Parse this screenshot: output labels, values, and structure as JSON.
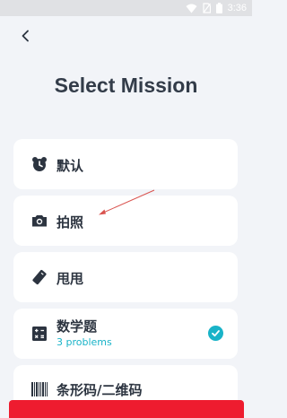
{
  "status_bar": {
    "time": "3:36"
  },
  "header": {
    "title": "Select Mission"
  },
  "missions": [
    {
      "label": "默认",
      "icon": "alarm-clock-icon"
    },
    {
      "label": "拍照",
      "icon": "camera-icon"
    },
    {
      "label": "甩甩",
      "icon": "shake-phone-icon"
    },
    {
      "label": "数学题",
      "sublabel": "3 problems",
      "icon": "calculator-icon",
      "selected": true
    },
    {
      "label": "条形码/二维码",
      "icon": "barcode-icon"
    }
  ],
  "colors": {
    "accent": "#19b3c8",
    "background": "#f2f4f8",
    "card": "#ffffff",
    "bottom_button": "#ee1c2f",
    "annotation_arrow": "#d9534f"
  }
}
